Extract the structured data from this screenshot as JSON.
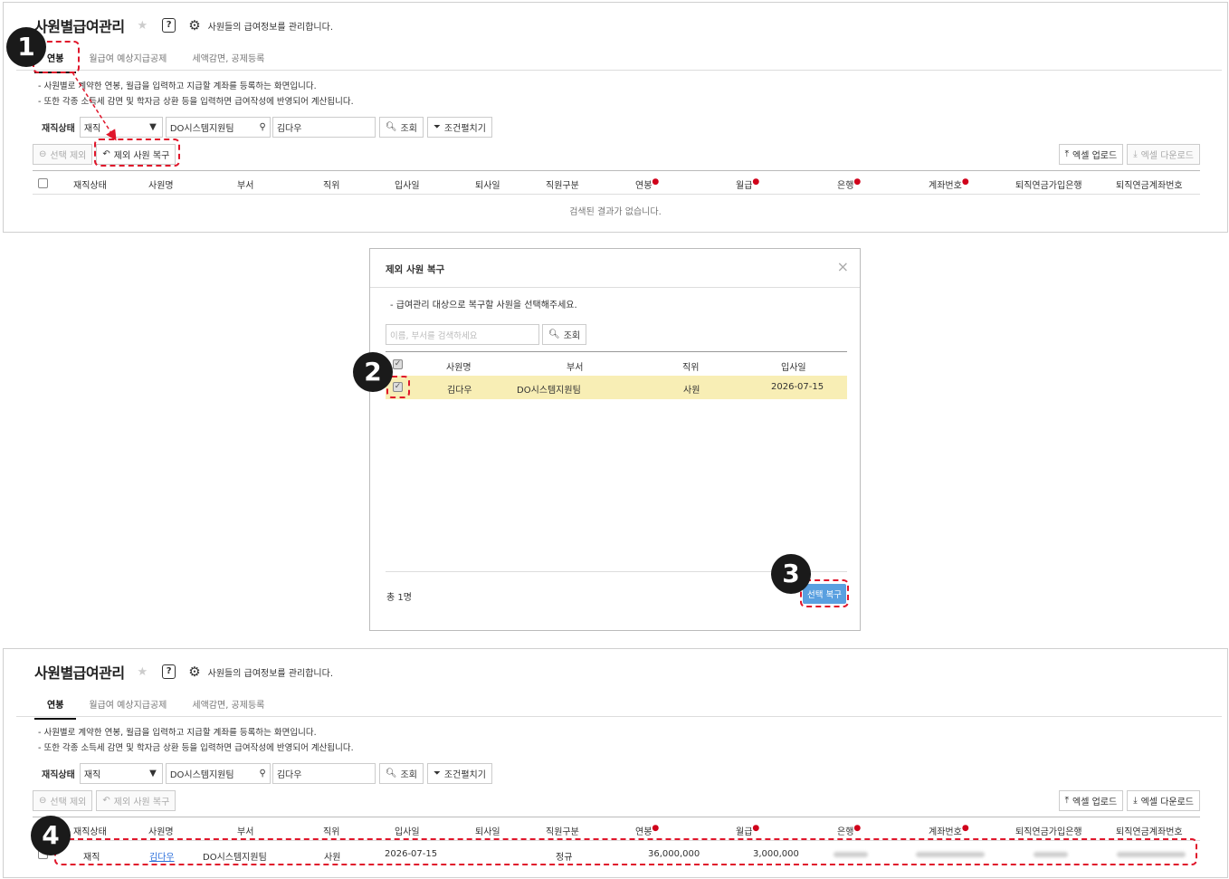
{
  "page": {
    "title": "사원별급여관리",
    "description": "사원들의 급여정보를 관리합니다.",
    "tabs": [
      "연봉",
      "월급여 예상지급공제",
      "세액감면, 공제등록"
    ],
    "notes": [
      "- 사원별로 계약한 연봉, 월급을 입력하고 지급할 계좌를 등록하는 화면입니다.",
      "- 또한 각종 소득세 감면 및 학자금 상환 등을 입력하면 급여작성에 반영되어 계산됩니다."
    ],
    "filter": {
      "label": "재직상태",
      "status_value": "재직",
      "dept_value": "DO시스템지원팀",
      "name_value": "김다우",
      "search_btn": "조회",
      "condition_btn": "조건펼치기"
    },
    "actions": {
      "exclude_btn": "선택 제외",
      "restore_btn": "제외 사원 복구",
      "excel_upload": "엑셀 업로드",
      "excel_download": "엑셀 다운로드"
    },
    "columns": [
      "재직상태",
      "사원명",
      "부서",
      "직위",
      "입사일",
      "퇴사일",
      "직원구분",
      "연봉",
      "월급",
      "은행",
      "계좌번호",
      "퇴직연금가입은행",
      "퇴직연금계좌번호"
    ],
    "empty_text": "검색된 결과가 없습니다.",
    "result_row": {
      "status": "재직",
      "name": "김다우",
      "dept": "DO시스템지원팀",
      "position": "사원",
      "join_date": "2026-07-15",
      "emp_type": "정규",
      "annual": "36,000,000",
      "monthly": "3,000,000"
    }
  },
  "modal": {
    "title": "제외 사원 복구",
    "close": "×",
    "note": "- 급여관리 대상으로 복구할 사원을 선택해주세요.",
    "search_placeholder": "이름, 부서를 검색하세요",
    "search_btn": "조회",
    "columns": [
      "사원명",
      "부서",
      "직위",
      "입사일"
    ],
    "row": {
      "name": "김다우",
      "dept": "DO시스템지원팀",
      "position": "사원",
      "join_date": "2026-07-15"
    },
    "total": "총 1명",
    "restore_btn": "선택 복구"
  },
  "badges": [
    "1",
    "2",
    "3",
    "4"
  ],
  "colors": {
    "annotation": "#e0162b",
    "highlight_row": "#f8eeb5",
    "primary_button": "#5aa0e0"
  },
  "icons": [
    "star-icon",
    "help-icon",
    "gear-icon",
    "org-chart-icon",
    "search-icon",
    "filter-icon",
    "minus-circle-icon",
    "undo-icon",
    "upload-icon",
    "download-icon",
    "close-icon",
    "check-icon"
  ]
}
